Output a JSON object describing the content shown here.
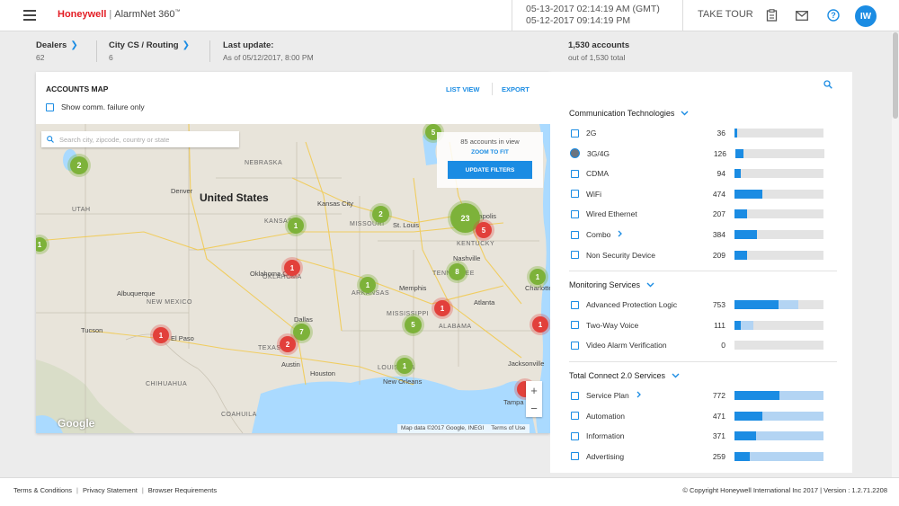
{
  "header": {
    "brand": "Honeywell",
    "app_name": "AlarmNet 360",
    "app_tm": "™",
    "time_gmt": "05-13-2017 02:14:19 AM (GMT)",
    "time_local": "05-12-2017 09:14:19 PM",
    "take_tour": "TAKE TOUR",
    "user_initials": "IW"
  },
  "subheader": {
    "dealers_label": "Dealers",
    "dealers_count": "62",
    "city_label": "City CS / Routing",
    "city_count": "6",
    "update_label": "Last update:",
    "update_value": "As of 05/12/2017, 8:00 PM",
    "accounts_label": "1,530 accounts",
    "accounts_sub": "out of 1,530 total"
  },
  "map_card": {
    "title": "ACCOUNTS MAP",
    "list_view": "LIST VIEW",
    "export": "EXPORT",
    "comm_failure_label": "Show comm. failure only",
    "search_placeholder": "Search city, zipcode, country or state",
    "accounts_in_view": "85 accounts in view",
    "zoom_to_fit": "ZOOM TO FIT",
    "update_filters": "UPDATE FILTERS",
    "zoom_in": "+",
    "zoom_out": "−",
    "google": "Google",
    "map_data": "Map data ©2017 Google, INEGI",
    "terms_of_use": "Terms of Use",
    "country_label": "United States",
    "states": [
      "NEBRASKA",
      "KANSAS",
      "MISSOURI",
      "OKLAHOMA",
      "ARKANSAS",
      "TEXAS",
      "NEW MEXICO",
      "MISSISSIPPI",
      "ALABAMA",
      "LOUISIANA",
      "KENTUCKY",
      "TENNESSEE",
      "UTAH",
      "CHIHUAHUA",
      "COAHUILA"
    ],
    "cities": [
      "Denver",
      "Kansas City",
      "St. Louis",
      "Indianapolis",
      "Nashville",
      "Atlanta",
      "Dallas",
      "Austin",
      "Houston",
      "New Orleans",
      "Tucson",
      "El Paso",
      "Albuquerque",
      "Memphis",
      "Jacksonville",
      "Tampa",
      "Charlotte",
      "Oklahoma City"
    ],
    "clusters": [
      {
        "count": "2",
        "status": "green"
      },
      {
        "count": "1",
        "status": "green"
      },
      {
        "count": "1",
        "status": "green"
      },
      {
        "count": "2",
        "status": "green"
      },
      {
        "count": "23",
        "status": "green"
      },
      {
        "count": "5",
        "status": "red"
      },
      {
        "count": "1",
        "status": "red"
      },
      {
        "count": "8",
        "status": "green"
      },
      {
        "count": "1",
        "status": "green"
      },
      {
        "count": "1",
        "status": "green"
      },
      {
        "count": "1",
        "status": "red"
      },
      {
        "count": "7",
        "status": "green"
      },
      {
        "count": "2",
        "status": "red"
      },
      {
        "count": "1",
        "status": "red"
      },
      {
        "count": "5",
        "status": "green"
      },
      {
        "count": "1",
        "status": "red"
      },
      {
        "count": "1",
        "status": "green"
      },
      {
        "count": "5",
        "status": "green"
      },
      {
        "count": "",
        "status": "red"
      }
    ]
  },
  "filters": {
    "groups": [
      {
        "title": "Communication Technologies",
        "items": [
          {
            "label": "2G",
            "count": "36",
            "fill": 0.035,
            "light": 0.035,
            "expandable": false,
            "checked": false
          },
          {
            "label": "3G/4G",
            "count": "126",
            "fill": 0.09,
            "light": 0.09,
            "expandable": false,
            "checked": "radio"
          },
          {
            "label": "CDMA",
            "count": "94",
            "fill": 0.07,
            "light": 0.07,
            "expandable": false,
            "checked": false
          },
          {
            "label": "WiFi",
            "count": "474",
            "fill": 0.31,
            "light": 0.31,
            "expandable": false,
            "checked": false
          },
          {
            "label": "Wired Ethernet",
            "count": "207",
            "fill": 0.14,
            "light": 0.14,
            "expandable": false,
            "checked": false
          },
          {
            "label": "Combo",
            "count": "384",
            "fill": 0.25,
            "light": 0.25,
            "expandable": true,
            "checked": false
          },
          {
            "label": "Non Security Device",
            "count": "209",
            "fill": 0.14,
            "light": 0.14,
            "expandable": false,
            "checked": false
          }
        ]
      },
      {
        "title": "Monitoring Services",
        "items": [
          {
            "label": "Advanced Protection Logic",
            "count": "753",
            "fill": 0.49,
            "light": 0.72,
            "expandable": false,
            "checked": false
          },
          {
            "label": "Two-Way Voice",
            "count": "111",
            "fill": 0.07,
            "light": 0.21,
            "expandable": false,
            "checked": false
          },
          {
            "label": "Video Alarm Verification",
            "count": "0",
            "fill": 0,
            "light": 0,
            "expandable": false,
            "checked": false
          }
        ]
      },
      {
        "title": "Total Connect 2.0 Services",
        "items": [
          {
            "label": "Service Plan",
            "count": "772",
            "fill": 0.5,
            "light": 1.0,
            "expandable": true,
            "checked": false
          },
          {
            "label": "Automation",
            "count": "471",
            "fill": 0.31,
            "light": 1.0,
            "expandable": false,
            "checked": false
          },
          {
            "label": "Information",
            "count": "371",
            "fill": 0.24,
            "light": 1.0,
            "expandable": false,
            "checked": false
          },
          {
            "label": "Advertising",
            "count": "259",
            "fill": 0.17,
            "light": 1.0,
            "expandable": false,
            "checked": false
          }
        ]
      }
    ]
  },
  "footer": {
    "terms": "Terms & Conditions",
    "privacy": "Privacy Statement",
    "browser": "Browser Requirements",
    "separator": "|",
    "copyright": "© Copyright Honeywell International Inc 2017 | Version : 1.2.71.2208"
  },
  "colors": {
    "accent": "#1b8ce3",
    "brand_red": "#e31d24",
    "cluster_green": "#7db23a",
    "cluster_red": "#e2403b",
    "bar_light": "#b3d4f3",
    "water": "#aadaff",
    "land": "#e8e4da"
  }
}
